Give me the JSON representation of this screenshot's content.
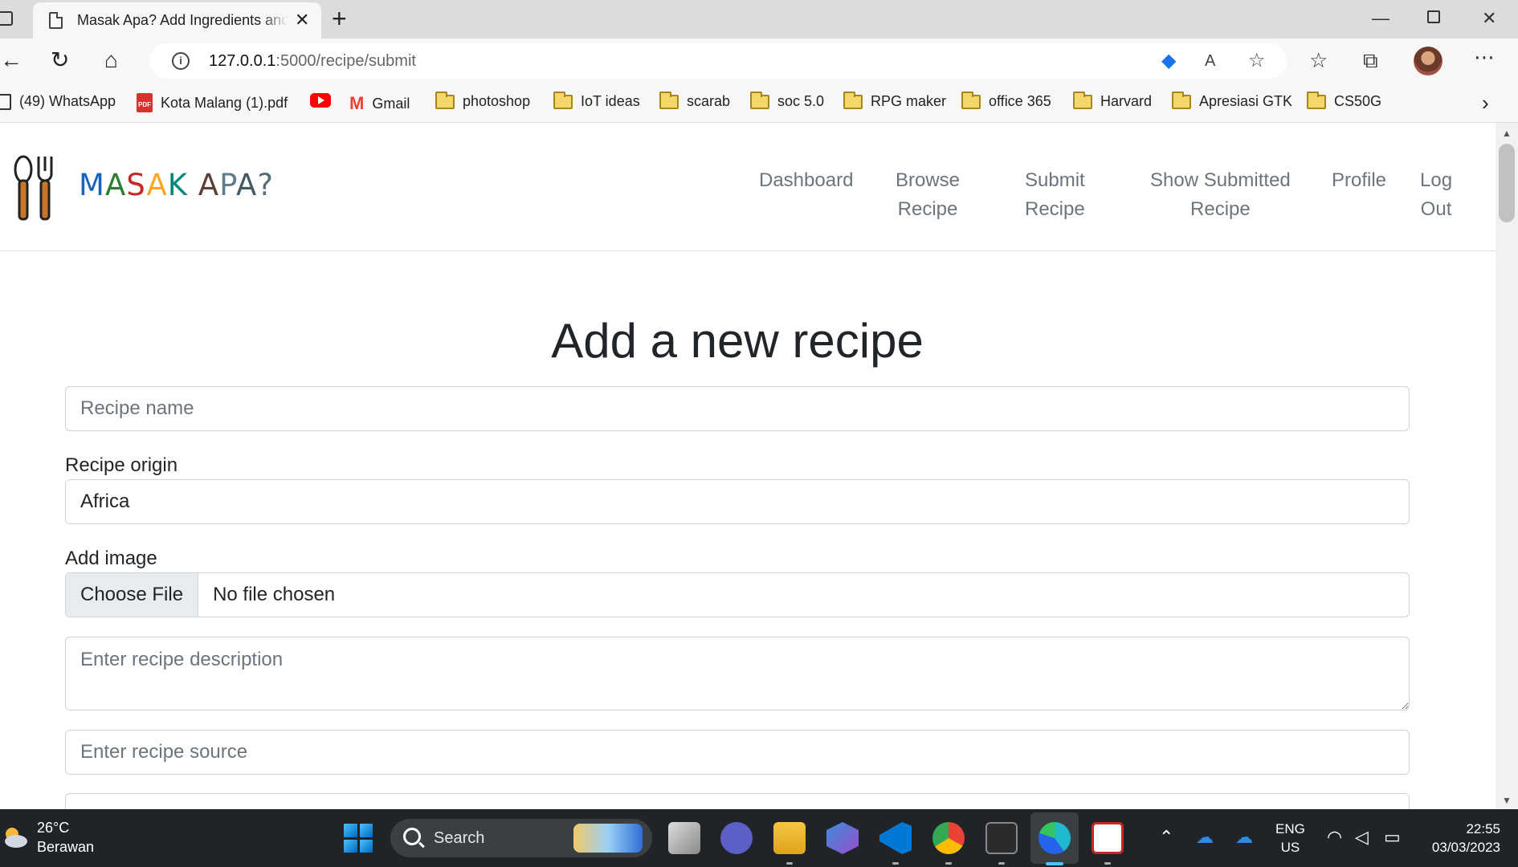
{
  "browser": {
    "tab_title": "Masak Apa? Add Ingredients and",
    "url_host": "127.0.0.1",
    "url_path": ":5000/recipe/submit",
    "bookmarks": [
      {
        "label": "(49) WhatsApp",
        "icon": "whatsapp-icon"
      },
      {
        "label": "Kota Malang (1).pdf",
        "icon": "pdf-icon"
      },
      {
        "label": "",
        "icon": "youtube-icon"
      },
      {
        "label": "Gmail",
        "icon": "gmail-icon"
      },
      {
        "label": "photoshop",
        "icon": "folder-icon"
      },
      {
        "label": "IoT ideas",
        "icon": "folder-icon"
      },
      {
        "label": "scarab",
        "icon": "folder-icon"
      },
      {
        "label": "soc 5.0",
        "icon": "folder-icon"
      },
      {
        "label": "RPG maker",
        "icon": "folder-icon"
      },
      {
        "label": "office 365",
        "icon": "folder-icon"
      },
      {
        "label": "Harvard",
        "icon": "folder-icon"
      },
      {
        "label": "Apresiasi GTK",
        "icon": "folder-icon"
      },
      {
        "label": "CS50G",
        "icon": "folder-icon"
      }
    ]
  },
  "site": {
    "brand": "MASAK APA?",
    "brand_colors": [
      "#1565c0",
      "#2e7d32",
      "#c62828",
      "#f9a825",
      "#00897b",
      "#5d4037",
      "#607d8b",
      "#455a64",
      "#546e7a",
      "#78909c"
    ],
    "nav": [
      {
        "line1": "Dashboard",
        "line2": ""
      },
      {
        "line1": "Browse",
        "line2": "Recipe"
      },
      {
        "line1": "Submit",
        "line2": "Recipe"
      },
      {
        "line1": "Show Submitted",
        "line2": "Recipe"
      },
      {
        "line1": "Profile",
        "line2": ""
      },
      {
        "line1": "Log",
        "line2": "Out"
      }
    ]
  },
  "form": {
    "heading": "Add a new recipe",
    "recipe_name_placeholder": "Recipe name",
    "origin_label": "Recipe origin",
    "origin_value": "Africa",
    "image_label": "Add image",
    "choose_file": "Choose File",
    "no_file": "No file chosen",
    "description_placeholder": "Enter recipe description",
    "source_placeholder": "Enter recipe source"
  },
  "taskbar": {
    "temperature": "26°C",
    "weather": "Berawan",
    "search": "Search",
    "lang_line1": "ENG",
    "lang_line2": "US",
    "time": "22:55",
    "date": "03/03/2023"
  }
}
